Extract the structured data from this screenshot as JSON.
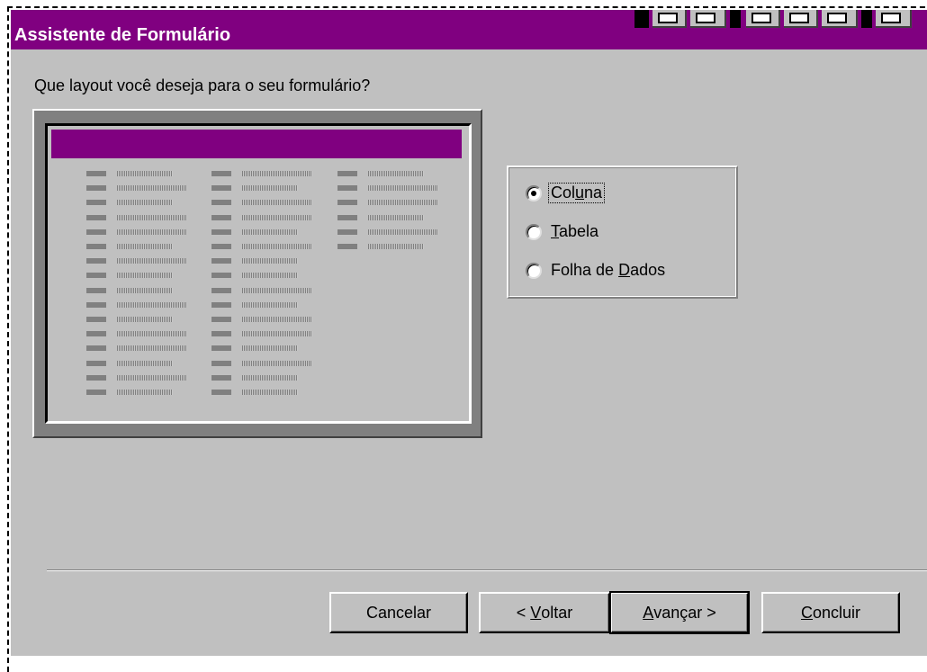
{
  "window": {
    "title": "Assistente de Formulário"
  },
  "question": "Que layout você deseja para o seu formulário?",
  "options": [
    {
      "pre": "Col",
      "accel": "u",
      "post": "na",
      "selected": true
    },
    {
      "pre": "",
      "accel": "T",
      "post": "abela",
      "selected": false
    },
    {
      "pre": "Folha de ",
      "accel": "D",
      "post": "ados",
      "selected": false
    }
  ],
  "buttons": {
    "cancel": {
      "pre": "Cancelar",
      "accel": "",
      "post": ""
    },
    "back": {
      "pre": "< ",
      "accel": "V",
      "post": "oltar"
    },
    "next": {
      "pre": "",
      "accel": "A",
      "post": "vançar >"
    },
    "finish": {
      "pre": "",
      "accel": "C",
      "post": "oncluir"
    }
  },
  "colors": {
    "titlebar": "#800080",
    "face": "#c0c0c0"
  }
}
